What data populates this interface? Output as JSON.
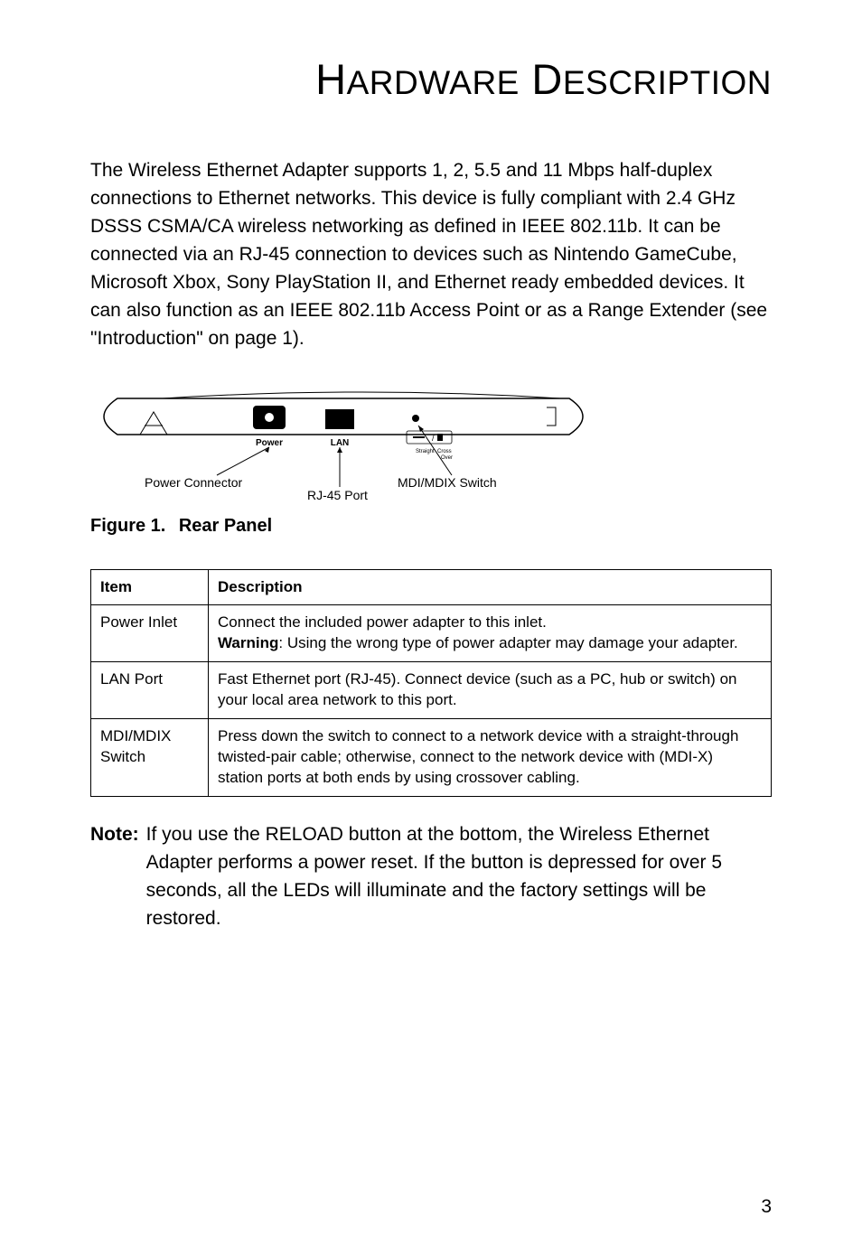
{
  "title": {
    "word1_cap": "H",
    "word1_rest": "ARDWARE",
    "word2_cap": "D",
    "word2_rest": "ESCRIPTION"
  },
  "intro": "The Wireless Ethernet Adapter supports 1, 2, 5.5 and 11 Mbps half-duplex connections to Ethernet networks. This device is fully compliant with 2.4 GHz DSSS CSMA/CA wireless networking as defined in IEEE 802.11b. It can be connected via an RJ-45 connection to devices such as Nintendo GameCube, Microsoft Xbox, Sony PlayStation II, and Ethernet ready embedded devices. It can also function as an IEEE 802.11b Access Point or as a Range Extender (see \"Introduction\" on page 1).",
  "diagram": {
    "power_label": "Power",
    "lan_label": "LAN",
    "switch_label_a": "Straight",
    "switch_label_b": "Cross\nOver",
    "callout_power": "Power Connector",
    "callout_rj45": "RJ-45 Port",
    "callout_mdi": "MDI/MDIX Switch"
  },
  "figure": {
    "label": "Figure 1.",
    "title": "Rear Panel"
  },
  "table": {
    "header_item": "Item",
    "header_desc": "Description",
    "rows": [
      {
        "item": "Power Inlet",
        "desc_line1": "Connect the included power adapter to this inlet.",
        "desc_warn_label": "Warning",
        "desc_warn_rest": ": Using the wrong type of power adapter may damage your adapter."
      },
      {
        "item": "LAN Port",
        "desc": "Fast Ethernet port (RJ-45). Connect device (such as a PC, hub or switch) on your local area network to this port."
      },
      {
        "item": "MDI/MDIX Switch",
        "desc": "Press down the switch to connect to a network device with a straight-through twisted-pair cable; otherwise, connect to the network device with (MDI-X) station ports at both ends by using crossover cabling."
      }
    ]
  },
  "note": {
    "label": "Note:",
    "body": "If you use the RELOAD button at the bottom, the Wireless Ethernet Adapter performs a power reset. If the button is depressed for over 5 seconds, all the LEDs will illuminate and the factory settings will be restored."
  },
  "page_number": "3"
}
